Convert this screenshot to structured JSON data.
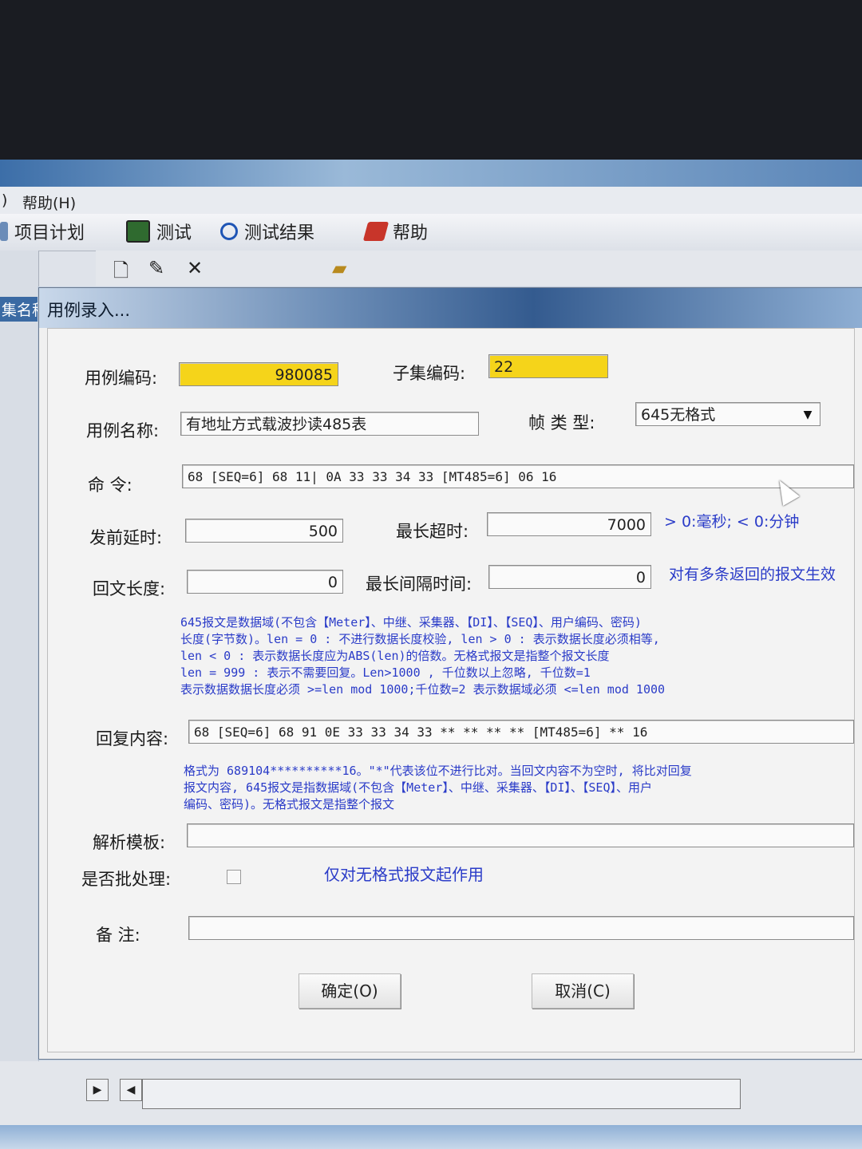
{
  "app": {
    "menu": {
      "paren": ")",
      "help": "帮助(H)"
    },
    "tabs": [
      {
        "label": "项目计划"
      },
      {
        "label": "测试"
      },
      {
        "label": "测试结果"
      },
      {
        "label": "帮助"
      }
    ],
    "left_panel_label": "集名称"
  },
  "dialog": {
    "title": "用例录入...",
    "case_code": {
      "label": "用例编码:",
      "value": "980085"
    },
    "subset_code": {
      "label": "子集编码:",
      "value": "22"
    },
    "case_name": {
      "label": "用例名称:",
      "value": "有地址方式载波抄读485表"
    },
    "frame_type": {
      "label": "帧 类 型:",
      "value": "645无格式"
    },
    "command": {
      "label": "命      令:",
      "value": "68 [SEQ=6] 68 11| 0A 33 33 34 33 [MT485=6] 06 16"
    },
    "pre_delay": {
      "label": "发前延时:",
      "value": "500"
    },
    "max_timeout": {
      "label": "最长超时:",
      "value": "7000"
    },
    "timeout_hint": "> 0:毫秒; < 0:分钟",
    "reply_length": {
      "label": "回文长度:",
      "value": "0"
    },
    "max_interval": {
      "label": "最长间隔时间:",
      "value": "0"
    },
    "interval_hint": "对有多条返回的报文生效",
    "length_notes": [
      "645报文是数据域(不包含【Meter】、中继、采集器、【DI】、【SEQ】、用户编码、密码)",
      "长度(字节数)。len = 0 : 不进行数据长度校验, len > 0 : 表示数据长度必须相等,",
      "len < 0 : 表示数据长度应为ABS(len)的倍数。无格式报文是指整个报文长度",
      "len = 999 : 表示不需要回复。Len>1000 , 千位数以上忽略, 千位数=1",
      "表示数据数据长度必须 >=len mod 1000;千位数=2 表示数据域必须 <=len mod 1000"
    ],
    "reply_content": {
      "label": "回复内容:",
      "value": "68 [SEQ=6] 68 91 0E 33 33 34 33 ** ** ** ** [MT485=6] ** 16"
    },
    "reply_notes": [
      "格式为 689104**********16。\"*\"代表该位不进行比对。当回文内容不为空时, 将比对回复",
      "报文内容, 645报文是指数据域(不包含【Meter】、中继、采集器、【DI】、【SEQ】、用户",
      "编码、密码)。无格式报文是指整个报文"
    ],
    "parse_template": {
      "label": "解析模板:",
      "value": ""
    },
    "batch": {
      "label": "是否批处理:",
      "hint": "仅对无格式报文起作用",
      "checked": false
    },
    "remark": {
      "label": "备      注:",
      "value": ""
    },
    "ok_button": "确定(O)",
    "cancel_button": "取消(C)"
  }
}
